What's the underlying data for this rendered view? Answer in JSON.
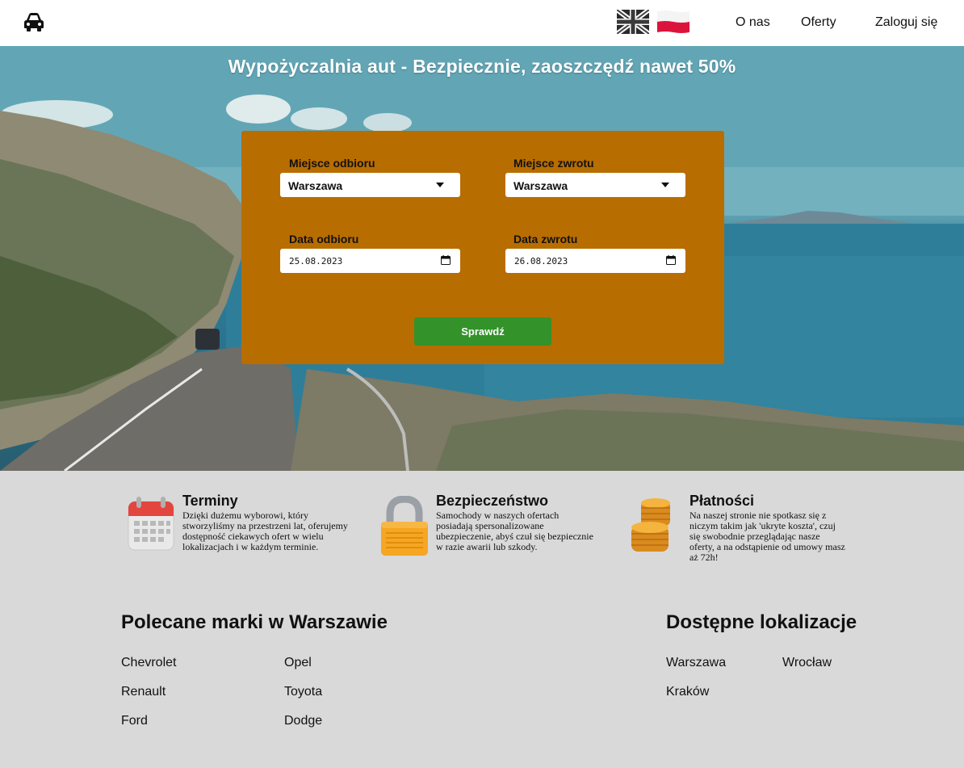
{
  "navbar": {
    "logo_icon": "car-icon",
    "flags": [
      "uk-flag-icon",
      "poland-flag-icon"
    ],
    "links": {
      "about": "O nas",
      "offers": "Oferty",
      "login": "Zaloguj się"
    }
  },
  "hero": {
    "title": "Wypożyczalnia aut - Bezpiecznie, zaoszczędź nawet 50%"
  },
  "form": {
    "pickup_place_label": "Miejsce odbioru",
    "pickup_place_value": "Warszawa",
    "return_place_label": "Miejsce zwrotu",
    "return_place_value": "Warszawa",
    "pickup_date_label": "Data odbioru",
    "pickup_date_value": "25.08.2023",
    "return_date_label": "Data zwrotu",
    "return_date_value": "26.08.2023",
    "submit_label": "Sprawdź",
    "colors": {
      "card": "#b86d00",
      "button": "#33922a"
    }
  },
  "features": [
    {
      "icon": "calendar-icon",
      "title": "Terminy",
      "text": "Dzięki dużemu wyborowi, który stworzyliśmy na przestrzeni lat, oferujemy dostępność ciekawych ofert w wielu lokalizacjach i w każdym terminie."
    },
    {
      "icon": "padlock-icon",
      "title": "Bezpieczeństwo",
      "text": "Samochody w naszych ofertach posiadają spersonalizowane ubezpieczenie, abyś czuł się bezpiecznie w razie awarii lub szkody."
    },
    {
      "icon": "coins-icon",
      "title": "Płatności",
      "text": "Na naszej stronie nie spotkasz się z niczym takim jak 'ukryte koszta', czuj się swobodnie przeglądając nasze oferty, a na odstąpienie od umowy masz aż 72h!"
    }
  ],
  "brands": {
    "title": "Polecane marki w Warszawie",
    "items": [
      "Chevrolet",
      "Opel",
      "Renault",
      "Toyota",
      "Ford",
      "Dodge"
    ]
  },
  "locations": {
    "title": "Dostępne lokalizacje",
    "items": [
      "Warszawa",
      "Wrocław",
      "Kraków"
    ]
  }
}
